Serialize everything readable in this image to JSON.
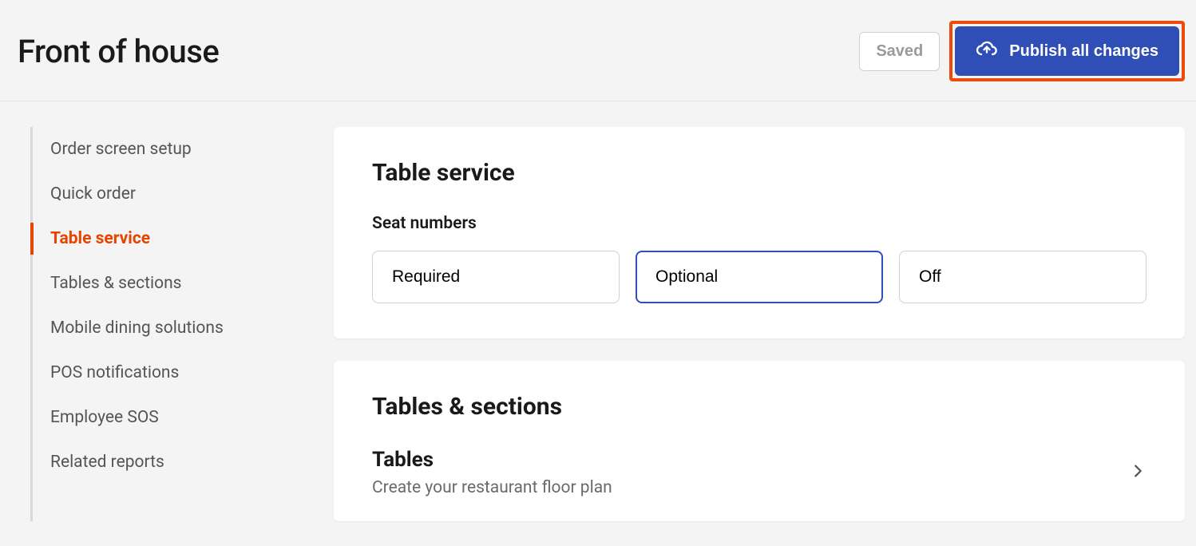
{
  "header": {
    "title": "Front of house",
    "saved_label": "Saved",
    "publish_label": "Publish all changes"
  },
  "sidebar": {
    "items": [
      {
        "label": "Order screen setup",
        "active": false
      },
      {
        "label": "Quick order",
        "active": false
      },
      {
        "label": "Table service",
        "active": true
      },
      {
        "label": "Tables & sections",
        "active": false
      },
      {
        "label": "Mobile dining solutions",
        "active": false
      },
      {
        "label": "POS notifications",
        "active": false
      },
      {
        "label": "Employee SOS",
        "active": false
      },
      {
        "label": "Related reports",
        "active": false
      }
    ]
  },
  "main": {
    "table_service": {
      "title": "Table service",
      "seat_numbers_label": "Seat numbers",
      "seat_numbers_options": {
        "required": "Required",
        "optional": "Optional",
        "off": "Off"
      },
      "seat_numbers_selected": "optional"
    },
    "tables_sections": {
      "title": "Tables & sections",
      "tables_row": {
        "title": "Tables",
        "subtitle": "Create your restaurant floor plan"
      }
    }
  }
}
